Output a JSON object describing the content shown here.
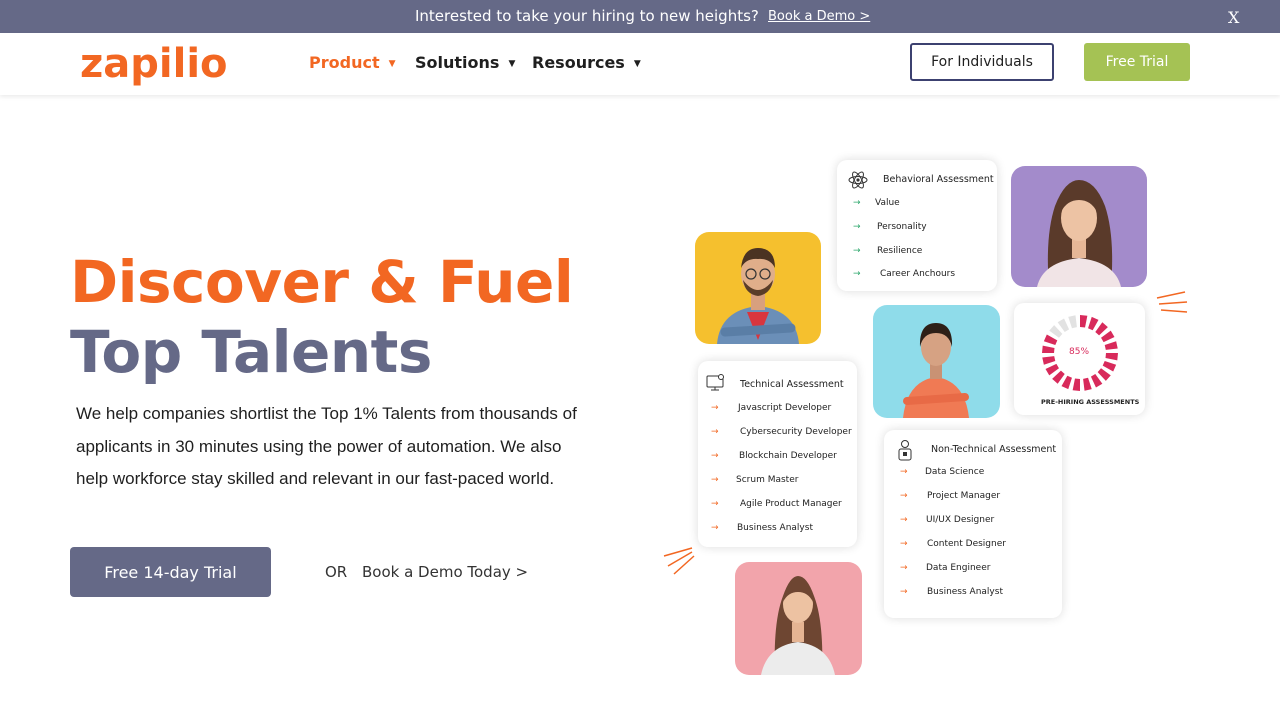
{
  "announcement": {
    "text": "Interested to take your hiring to new heights?",
    "link": "Book a Demo >",
    "close": "X"
  },
  "nav": {
    "logo": "zapilio",
    "items": [
      {
        "label": "Product",
        "active": true
      },
      {
        "label": "Solutions",
        "active": false
      },
      {
        "label": "Resources",
        "active": false
      }
    ],
    "individuals_label": "For Individuals",
    "trial_label": "Free Trial"
  },
  "hero": {
    "title_line1": "Discover & Fuel",
    "title_line2": "Top Talents",
    "description": "We help companies shortlist the Top 1% Talents from thousands of applicants in 30 minutes using the power of automation. We also help workforce stay skilled and relevant in our fast-paced world.",
    "trial_button": "Free 14-day Trial",
    "or_text": "OR",
    "demo_link": "Book a Demo Today >"
  },
  "illustration": {
    "behavioral": {
      "title": "Behavioral Assessment",
      "items": [
        "Value",
        "Personality",
        "Resilience",
        "Career Anchours"
      ]
    },
    "technical": {
      "title": "Technical Assessment",
      "items": [
        "Javascript Developer",
        "Cybersecurity Developer",
        "Blockchain Developer",
        "Scrum Master",
        "Agile Product Manager",
        "Business Analyst"
      ]
    },
    "non_technical": {
      "title": "Non-Technical Assessment",
      "items": [
        "Data Science",
        "Project Manager",
        "UI/UX Designer",
        "Content Designer",
        "Data Engineer",
        "Business Analyst"
      ]
    },
    "gauge": {
      "percent_label": "85%",
      "percent_value": 85,
      "label": "PRE-HIRING ASSESSMENTS"
    },
    "arrow_glyph": "→"
  },
  "colors": {
    "brand_orange": "#f26722",
    "slate": "#656987",
    "green": "#a5c254",
    "gauge_red": "#d82a5b"
  }
}
